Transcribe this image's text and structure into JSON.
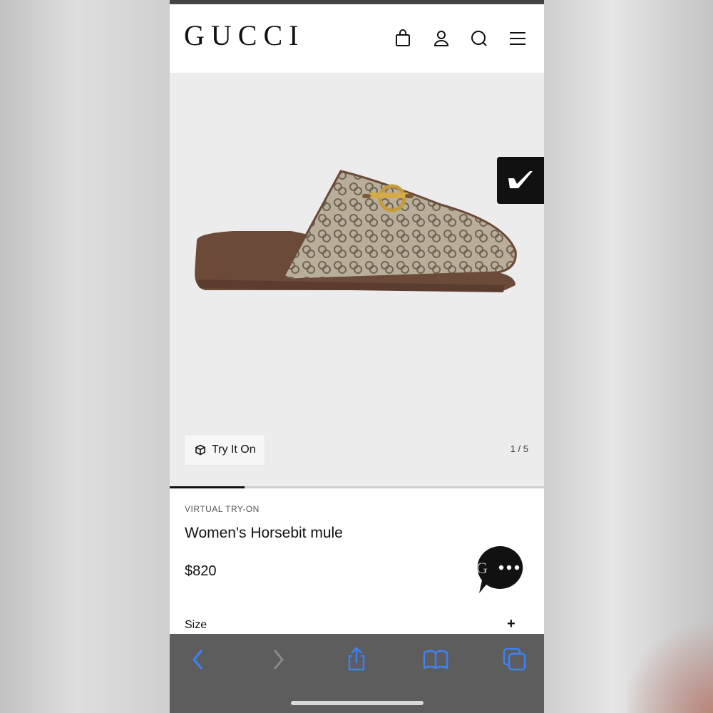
{
  "header": {
    "logo_text": "GUCCI",
    "icons": [
      "shopping-bag-icon",
      "account-icon",
      "search-icon",
      "menu-icon"
    ]
  },
  "product": {
    "eyebrow": "VIRTUAL TRY-ON",
    "title": "Women's Horsebit mule",
    "price": "$820"
  },
  "gallery": {
    "try_on_label": "Try It On",
    "counter": "1 / 5",
    "current_image": 1,
    "total_images": 5,
    "progress_fraction": 0.2
  },
  "size": {
    "label": "Size",
    "expand_symbol": "+"
  },
  "colors": {
    "accent": "#111111",
    "safari_blue": "#3b82f6",
    "toolbar_bg": "#5d5d5d"
  },
  "toolbar": {
    "icons": [
      "back-icon",
      "forward-icon",
      "share-icon",
      "bookmarks-icon",
      "tabs-icon"
    ]
  }
}
